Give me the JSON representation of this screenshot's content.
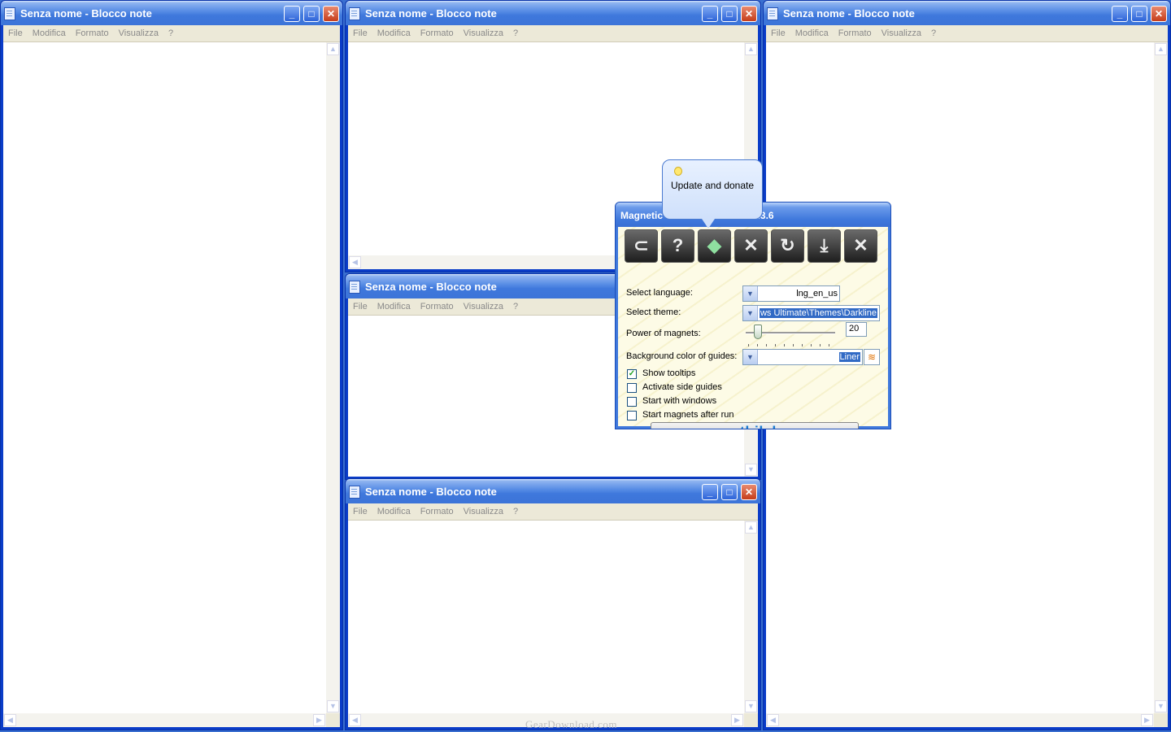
{
  "notepad": {
    "title": "Senza nome - Blocco note",
    "menu": [
      "File",
      "Modifica",
      "Formato",
      "Visualizza",
      "?"
    ]
  },
  "dialog": {
    "title": "Magnetic Windows Ultimate 2.3.6",
    "tooltip": "Update and donate",
    "labels": {
      "language": "Select language:",
      "theme": "Select theme:",
      "power": "Power of magnets:",
      "bgcolor": "Background color of guides:"
    },
    "language_value": "lng_en_us",
    "theme_value": "ws Ultimate\\Themes\\Darkline",
    "power_value": "20",
    "power_level": 0.15,
    "bgcolor_value": "Liner",
    "checkboxes": [
      {
        "label": "Show tooltips",
        "checked": true
      },
      {
        "label": "Activate side guides",
        "checked": false
      },
      {
        "label": "Start with windows",
        "checked": false
      },
      {
        "label": "Start magnets after run",
        "checked": false
      }
    ],
    "website": "www.sethilabs.com",
    "toolbar_icons": [
      "magnet-icon",
      "help-icon",
      "update-gem-icon",
      "settings-tools-icon",
      "refresh-icon",
      "minimize-to-tray-icon",
      "close-x-icon"
    ]
  },
  "watermark": "GearDownload.com"
}
